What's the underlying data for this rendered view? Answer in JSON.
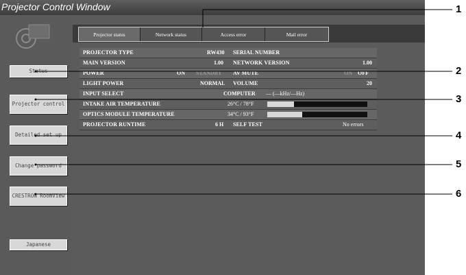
{
  "window": {
    "title": "Projector Control Window"
  },
  "sidebar": {
    "buttons": [
      {
        "label": "Status"
      },
      {
        "label": "Projector control"
      },
      {
        "label": "Detailed set up"
      },
      {
        "label": "Change password"
      },
      {
        "label": "CRESTRON RoomView"
      },
      {
        "label": "Japanese"
      }
    ]
  },
  "tabs": [
    "Projector status",
    "Network status",
    "Access error",
    "Mail error"
  ],
  "status": {
    "projector_type": {
      "label": "PROJECTOR TYPE",
      "value": "RW430"
    },
    "serial_number": {
      "label": "SERIAL NUMBER",
      "value": ""
    },
    "main_version": {
      "label": "MAIN VERSION",
      "value": "1.00"
    },
    "network_version": {
      "label": "NETWORK VERSION",
      "value": "1.00"
    },
    "power": {
      "label": "POWER",
      "on": "ON",
      "standby": "STANDBY"
    },
    "av_mute": {
      "label": "AV MUTE",
      "on": "ON",
      "off": "OFF"
    },
    "light_power": {
      "label": "LIGHT POWER",
      "value": "NORMAL"
    },
    "volume": {
      "label": "VOLUME",
      "value": "20"
    },
    "input_select": {
      "label": "INPUT SELECT",
      "value": "COMPUTER",
      "freq": "— (—kHz/—Hz)"
    },
    "intake_air_temp": {
      "label": "INTAKE AIR TEMPERATURE",
      "value": "26°C / 78°F",
      "level": 0.27
    },
    "optics_module_temp": {
      "label": "OPTICS MODULE TEMPERATURE",
      "value": "34°C / 93°F",
      "level": 0.35
    },
    "runtime": {
      "label": "PROJECTOR RUNTIME",
      "value": "6 H"
    },
    "self_test": {
      "label": "SELF TEST",
      "value": "No errors"
    }
  },
  "callouts": [
    "1",
    "2",
    "3",
    "4",
    "5",
    "6"
  ],
  "colors": {
    "callout_line": "#000000",
    "window_bg": "#4a4a4a",
    "bar_fill": "#d8d8d8"
  }
}
